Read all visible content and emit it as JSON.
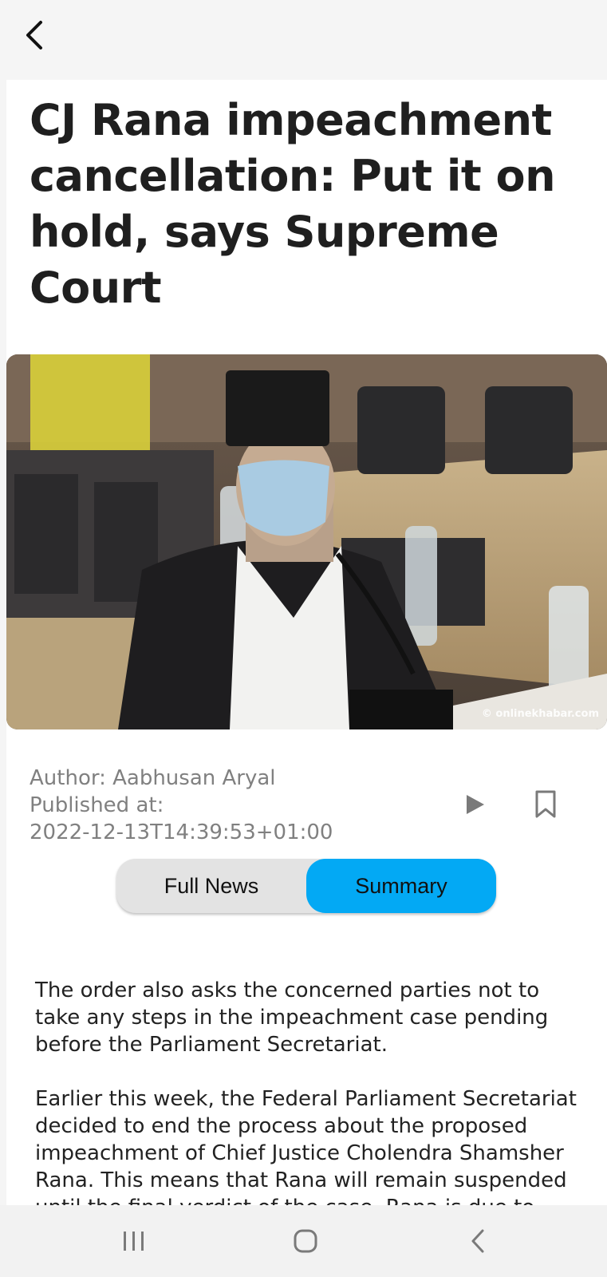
{
  "header": {
    "back_icon": "chevron-left-icon"
  },
  "article": {
    "title": "CJ Rana impeachment cancellation: Put it on hold, says Supreme Court",
    "image_watermark": "© onlinekhabar.com",
    "author_line": "Author: Aabhusan Aryal",
    "published_label": "Published at:",
    "published_value": "2022-12-13T14:39:53+01:00",
    "paragraphs": [
      "The order also asks the concerned parties not to take any steps in the impeachment case pending before the Parliament Secretariat.",
      "Earlier this week, the Federal Parliament Secretariat decided to end the process about the proposed impeachment of Chief Justice Cholendra Shamsher Rana. This means that Rana will remain suspended until the final verdict of the case. Rana is due to"
    ]
  },
  "actions": {
    "play_icon": "play-icon",
    "bookmark_icon": "bookmark-icon"
  },
  "toggle": {
    "full_news_label": "Full News",
    "summary_label": "Summary",
    "selected": "Summary"
  },
  "colors": {
    "accent": "#03a9f4",
    "meta_text": "#808080",
    "title_text": "#1f1f1f"
  },
  "system_nav": {
    "recents_icon": "recents-icon",
    "home_icon": "home-icon",
    "back_icon": "back-icon"
  }
}
